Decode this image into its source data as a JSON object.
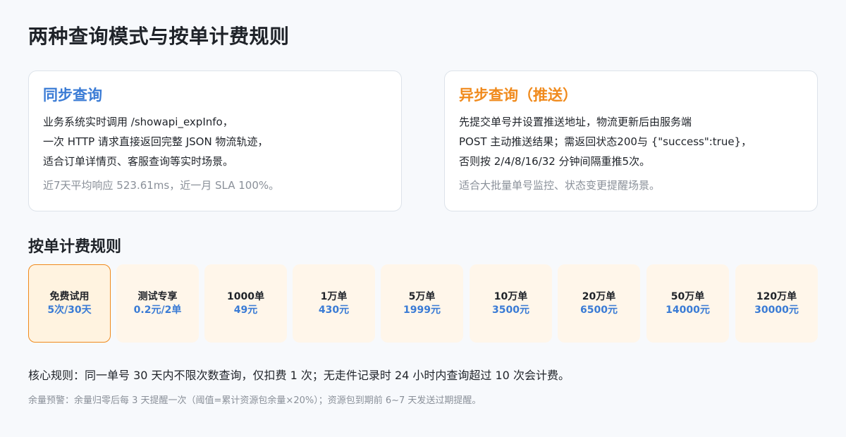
{
  "page_title": "两种查询模式与按单计费规则",
  "modes": {
    "sync": {
      "title": "同步查询",
      "lines": [
        "业务系统实时调用 /showapi_expInfo，",
        "一次 HTTP 请求直接返回完整 JSON 物流轨迹，",
        "适合订单详情页、客服查询等实时场景。"
      ],
      "note": "近7天平均响应 523.61ms，近一月 SLA 100%。"
    },
    "async": {
      "title": "异步查询（推送）",
      "lines": [
        "先提交单号并设置推送地址，物流更新后由服务端",
        "POST 主动推送结果；需返回状态200与 {\"success\":true}，",
        "否则按 2/4/8/16/32 分钟间隔重推5次。"
      ],
      "note": "适合大批量单号监控、状态变更提醒场景。"
    }
  },
  "billing": {
    "section_title": "按单计费规则",
    "selected_index": 0,
    "tiers": [
      {
        "name": "免费试用",
        "price": "5次/30天"
      },
      {
        "name": "测试专享",
        "price": "0.2元/2单"
      },
      {
        "name": "1000单",
        "price": "49元"
      },
      {
        "name": "1万单",
        "price": "430元"
      },
      {
        "name": "5万单",
        "price": "1999元"
      },
      {
        "name": "10万单",
        "price": "3500元"
      },
      {
        "name": "20万单",
        "price": "6500元"
      },
      {
        "name": "50万单",
        "price": "14000元"
      },
      {
        "name": "120万单",
        "price": "30000元"
      }
    ],
    "core_rule": "核心规则：同一单号 30 天内不限次数查询，仅扣费 1 次；无走件记录时 24 小时内查询超过 10 次会计费。",
    "balance_note": "余量预警：余量归零后每 3 天提醒一次（阈值=累计资源包余量×20%）；资源包到期前 6~7 天发送过期提醒。"
  },
  "colors": {
    "sync_accent": "#3a7bd5",
    "async_accent": "#f08a1c",
    "tier_background": "#fff6ea",
    "selected_border": "#f08a1c",
    "price_text": "#3a7bd5"
  }
}
